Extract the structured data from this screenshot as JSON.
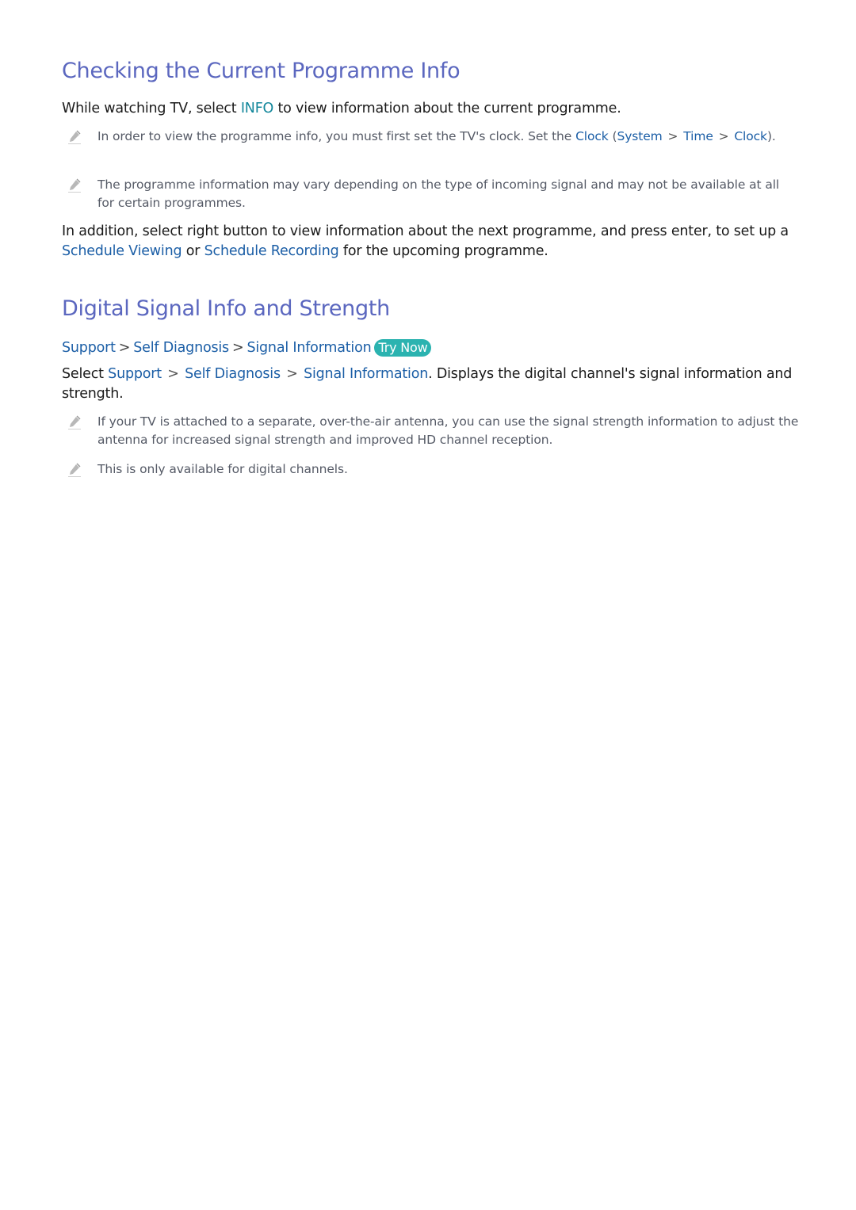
{
  "section1": {
    "title": "Checking the Current Programme Info",
    "intro": {
      "pre": "While watching TV, select ",
      "key": "INFO",
      "post": " to view information about the current programme."
    },
    "note1": {
      "pre": "In order to view the programme info, you must first set the TV's clock. Set the ",
      "clock": "Clock",
      "open": " (",
      "system": "System",
      "sep1": " > ",
      "time": "Time",
      "sep2": " > ",
      "clock2": "Clock",
      "close": ")."
    },
    "note2": "The programme information may vary depending on the type of incoming signal and may not be available at all for certain programmes.",
    "addition": {
      "pre": "In addition, select right button to view information about the next programme, and press enter, to set up a ",
      "link1": "Schedule Viewing",
      "mid": " or ",
      "link2": "Schedule Recording",
      "post": " for the upcoming programme."
    }
  },
  "section2": {
    "title": "Digital Signal Info and Strength",
    "breadcrumb": [
      "Support",
      "Self Diagnosis",
      "Signal Information"
    ],
    "breadcrumb_sep": ">",
    "try_now": "Try Now",
    "select": {
      "pre": "Select ",
      "support": "Support",
      "sep1": " > ",
      "self_diag": "Self Diagnosis",
      "sep2": " > ",
      "signal_info": "Signal Information",
      "post": ". Displays the digital channel's signal information and strength."
    },
    "note1": "If your TV is attached to a separate, over-the-air antenna, you can use the signal strength information to adjust the antenna for increased signal strength and improved HD channel reception.",
    "note2": "This is only available for digital channels."
  },
  "colors": {
    "heading": "#5b67bf",
    "link": "#1b5ea6",
    "key": "#13879b",
    "try_now_bg": "#2bb3b0",
    "note_text": "#555a66"
  }
}
